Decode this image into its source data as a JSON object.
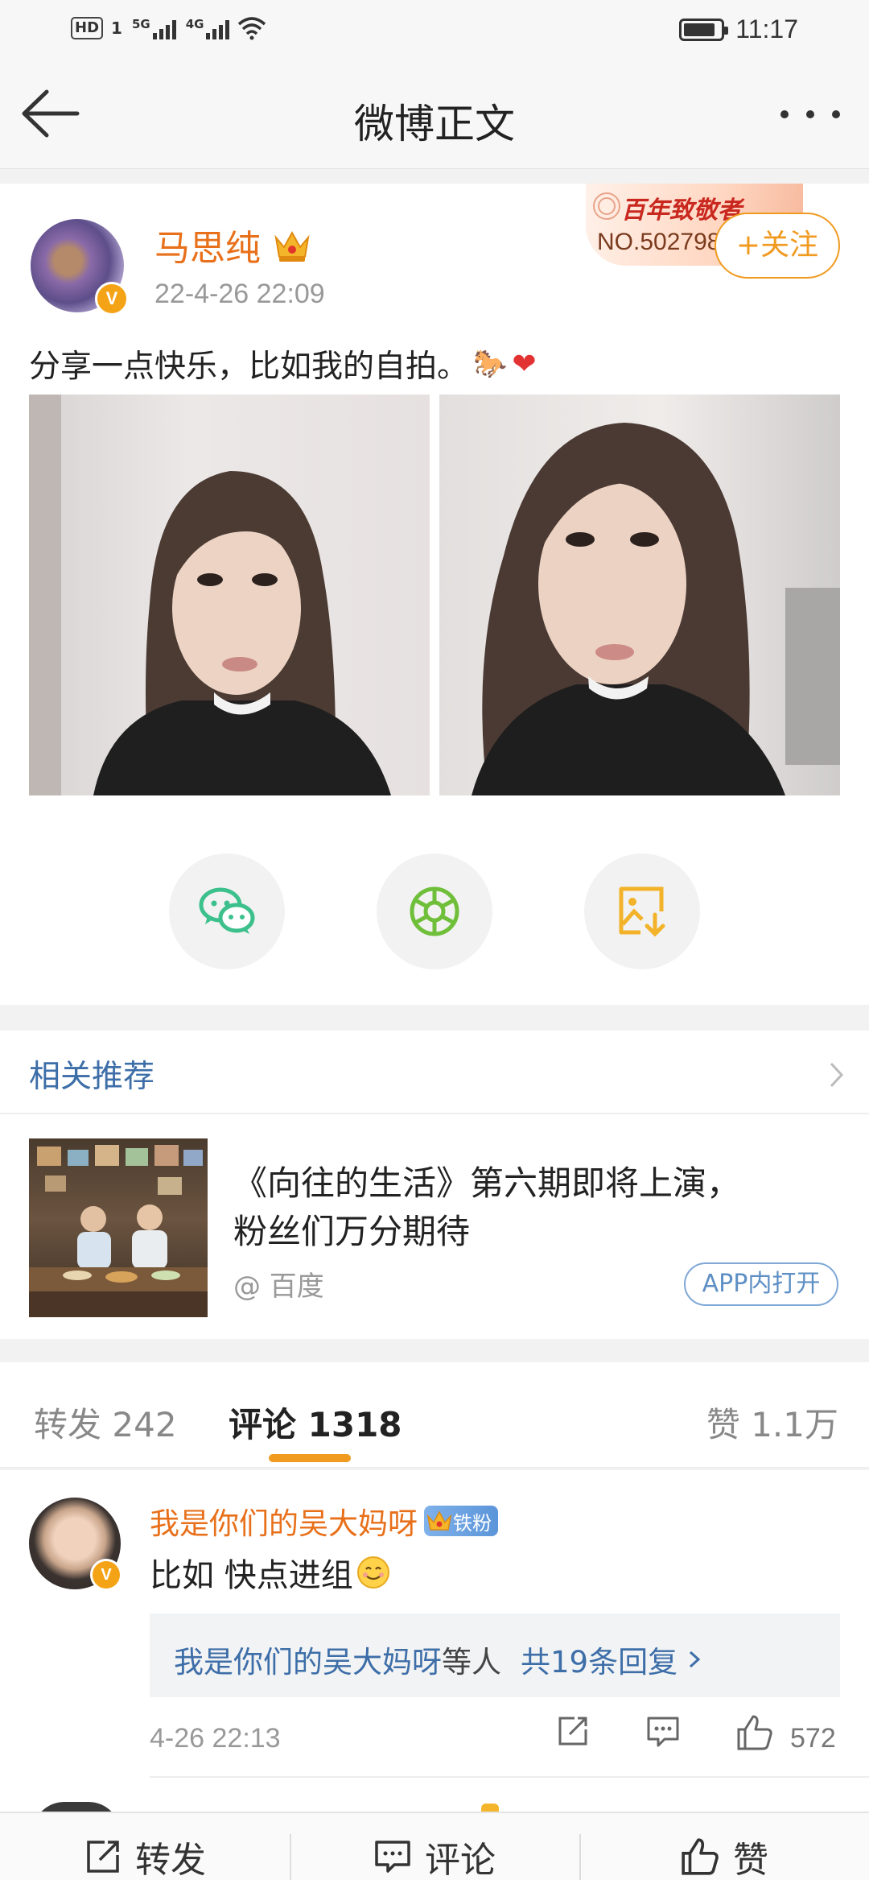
{
  "status_bar": {
    "left_badge": "HD",
    "sim_1": "1",
    "net_1": "5G",
    "net_2": "4G",
    "time": "11:17"
  },
  "nav": {
    "title": "微博正文"
  },
  "post": {
    "author": "马思纯",
    "time": "22-4-26 22:09",
    "fan_badge_title": "百年致敬者",
    "fan_badge_number": "NO.502798",
    "follow_label": "+关注",
    "text": "分享一点快乐，比如我的自拍。",
    "emoji_1": "🐎",
    "emoji_2": "❤",
    "share_icons": [
      "wechat-icon",
      "moments-icon",
      "save-image-icon"
    ]
  },
  "related": {
    "title": "相关推荐",
    "headline_line1": "《向往的生活》第六期即将上演，",
    "headline_line2": "粉丝们万分期待",
    "source": "@ 百度",
    "open_in_app": "APP内打开"
  },
  "tabs": {
    "repost_label": "转发",
    "repost_count": "242",
    "comment_label": "评论",
    "comment_count": "1318",
    "like_label": "赞",
    "like_count": "1.1万"
  },
  "comment": {
    "name": "我是你们的吴大妈呀",
    "fan_tag": "铁粉",
    "text": "比如 快点进组",
    "reply_users": "我是你们的吴大妈呀",
    "reply_etc": "等人",
    "reply_count": "共19条回复",
    "time": "4-26 22:13",
    "likes": "572"
  },
  "bottom_bar": {
    "repost": "转发",
    "comment": "评论",
    "like": "赞"
  },
  "colors": {
    "accent_orange": "#e8701a",
    "follow_orange": "#f09a20",
    "link_blue": "#3d6ea8",
    "wechat_green": "#3cc08c",
    "save_yellow": "#f2b32a"
  }
}
